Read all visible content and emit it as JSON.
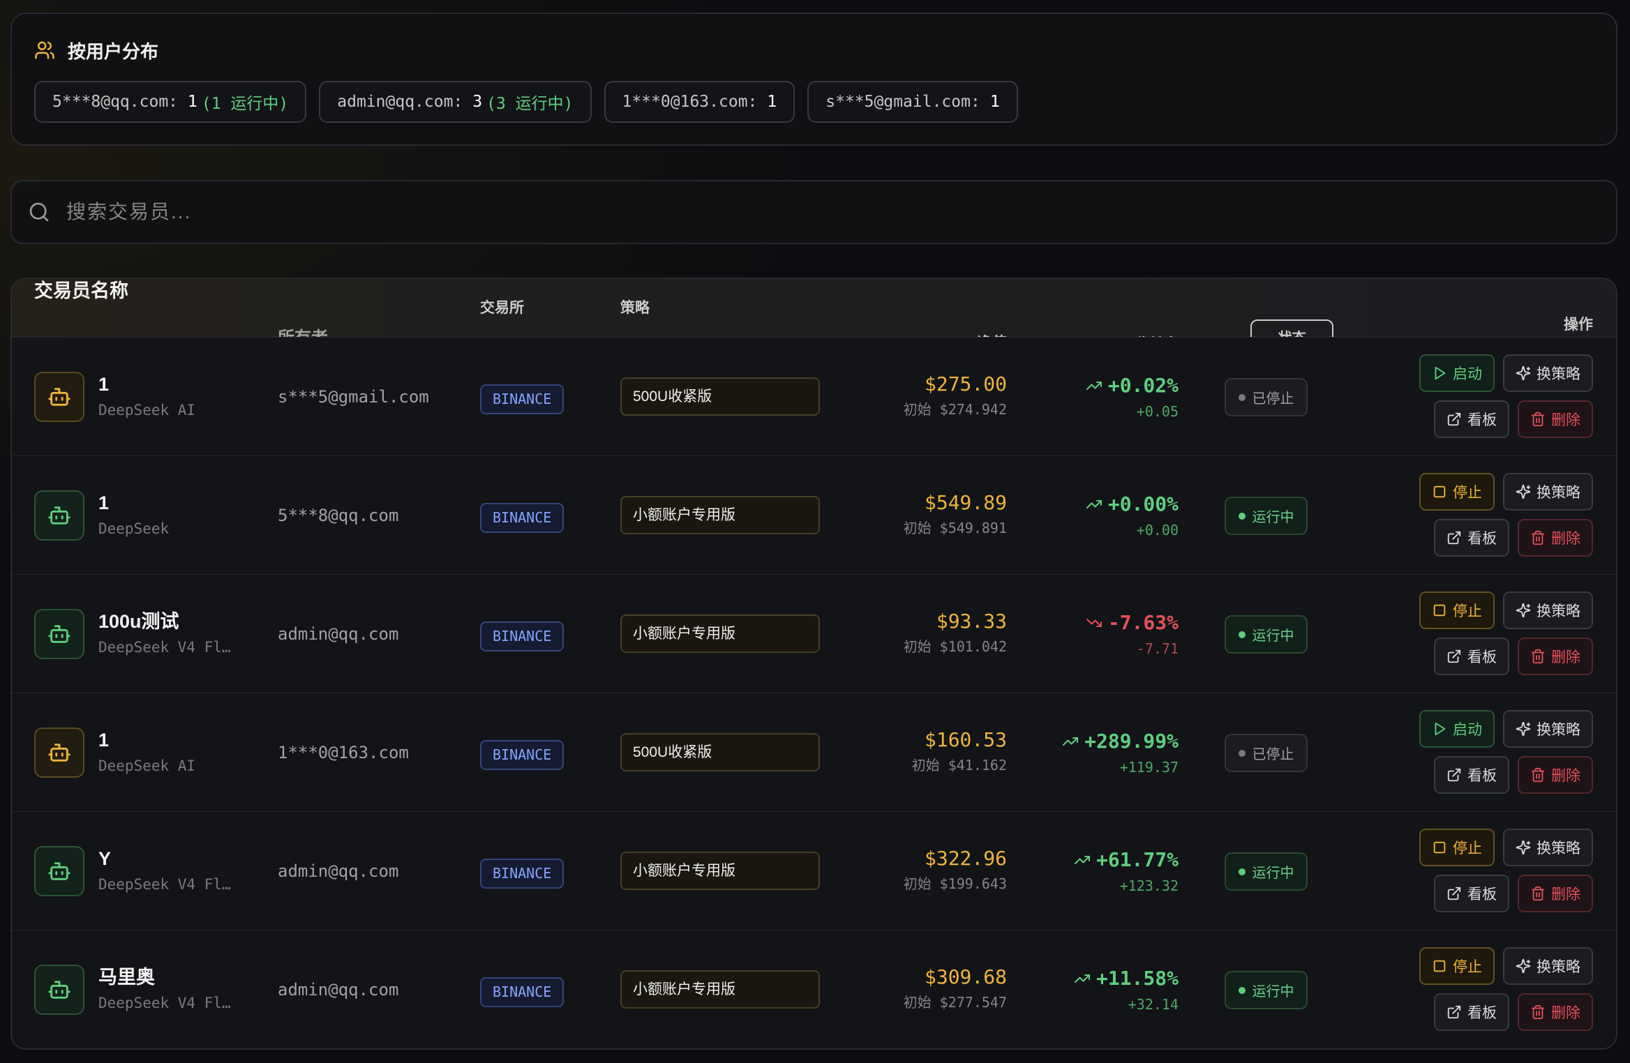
{
  "colors": {
    "yellow": "#efb43b",
    "green": "#5fcf7e",
    "red": "#e5505a",
    "blue": "#86a3ff"
  },
  "user_distribution": {
    "title": "按用户分布",
    "chips": [
      {
        "label": "5***8@qq.com:",
        "count": "1",
        "running": "(1 运行中)"
      },
      {
        "label": "admin@qq.com:",
        "count": "3",
        "running": "(3 运行中)"
      },
      {
        "label": "1***0@163.com:",
        "count": "1"
      },
      {
        "label": "s***5@gmail.com:",
        "count": "1"
      }
    ]
  },
  "search": {
    "placeholder": "搜索交易员..."
  },
  "table": {
    "headers": {
      "name": "交易员名称",
      "owner": "所有者",
      "exchange": "交易所",
      "strategy": "策略",
      "net": "净值",
      "return": "收益率",
      "status": "状态",
      "actions": "操作"
    },
    "actions": {
      "switch": "换策略",
      "board": "看板",
      "delete": "删除"
    },
    "rows": [
      {
        "name": "1",
        "model": "DeepSeek AI",
        "owner": "s***5@gmail.com",
        "exchange": "BINANCE",
        "strategy": "500U收紧版",
        "net_value": "$275.00",
        "initial": "初始 $274.942",
        "return_pct": "+0.02%",
        "pnl": "+0.05",
        "trend_icon": "trending-up-icon",
        "status": "已停止",
        "action": "启动",
        "action_icon": "play-icon"
      },
      {
        "name": "1",
        "model": "DeepSeek",
        "owner": "5***8@qq.com",
        "exchange": "BINANCE",
        "strategy": "小额账户专用版",
        "net_value": "$549.89",
        "initial": "初始 $549.891",
        "return_pct": "+0.00%",
        "pnl": "+0.00",
        "trend_icon": "trending-up-icon",
        "status": "运行中",
        "action": "停止",
        "action_icon": "square-icon"
      },
      {
        "name": "100u测试",
        "model": "DeepSeek V4 Fl…",
        "owner": "admin@qq.com",
        "exchange": "BINANCE",
        "strategy": "小额账户专用版",
        "net_value": "$93.33",
        "initial": "初始 $101.042",
        "return_pct": "-7.63%",
        "pnl": "-7.71",
        "trend_icon": "trending-down-icon",
        "status": "运行中",
        "action": "停止",
        "action_icon": "square-icon"
      },
      {
        "name": "1",
        "model": "DeepSeek AI",
        "owner": "1***0@163.com",
        "exchange": "BINANCE",
        "strategy": "500U收紧版",
        "net_value": "$160.53",
        "initial": "初始 $41.162",
        "return_pct": "+289.99%",
        "pnl": "+119.37",
        "trend_icon": "trending-up-icon",
        "status": "已停止",
        "action": "启动",
        "action_icon": "play-icon"
      },
      {
        "name": "Y",
        "model": "DeepSeek V4 Fl…",
        "owner": "admin@qq.com",
        "exchange": "BINANCE",
        "strategy": "小额账户专用版",
        "net_value": "$322.96",
        "initial": "初始 $199.643",
        "return_pct": "+61.77%",
        "pnl": "+123.32",
        "trend_icon": "trending-up-icon",
        "status": "运行中",
        "action": "停止",
        "action_icon": "square-icon"
      },
      {
        "name": "马里奥",
        "model": "DeepSeek V4 Fl…",
        "owner": "admin@qq.com",
        "exchange": "BINANCE",
        "strategy": "小额账户专用版",
        "net_value": "$309.68",
        "initial": "初始 $277.547",
        "return_pct": "+11.58%",
        "pnl": "+32.14",
        "trend_icon": "trending-up-icon",
        "status": "运行中",
        "action": "停止",
        "action_icon": "square-icon"
      }
    ]
  }
}
